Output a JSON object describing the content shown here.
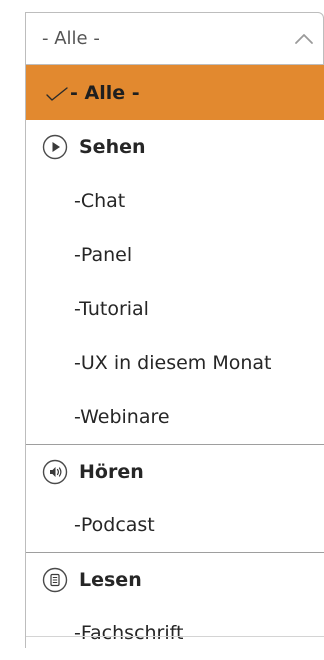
{
  "select": {
    "value": "- Alle -",
    "expanded": true
  },
  "options": {
    "alle": {
      "label": "- Alle -",
      "selected": true
    },
    "sehen": {
      "label": "Sehen",
      "icon": "play-circle-icon"
    },
    "chat": {
      "label": "-Chat"
    },
    "panel": {
      "label": "-Panel"
    },
    "tutorial": {
      "label": "-Tutorial"
    },
    "ux": {
      "label": "-UX in diesem Monat"
    },
    "webinare": {
      "label": "-Webinare"
    },
    "hoeren": {
      "label": "Hören",
      "icon": "speaker-circle-icon"
    },
    "podcast": {
      "label": "-Podcast"
    },
    "lesen": {
      "label": "Lesen",
      "icon": "document-circle-icon"
    },
    "fachschrift": {
      "label": "-Fachschrift"
    }
  },
  "colors": {
    "selected_bg": "#e2892f",
    "border": "#bdbdbd",
    "text": "#262626"
  }
}
